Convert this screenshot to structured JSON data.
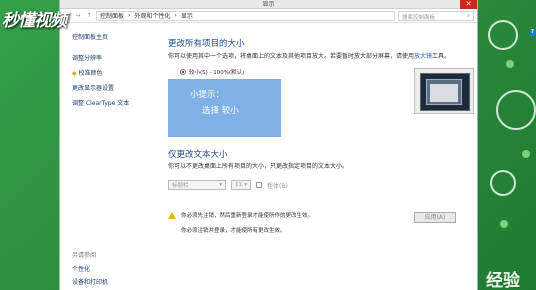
{
  "watermark": {
    "top_left": "秒懂视频",
    "bottom_right": "经验"
  },
  "window": {
    "title": "显示",
    "close": "✕"
  },
  "address": {
    "back": "←",
    "forward": "→",
    "up": "↑",
    "crumbs": [
      "控制面板",
      "外观和个性化",
      "显示"
    ],
    "search_placeholder": "搜索控制面板"
  },
  "sidebar": {
    "home": "控制面板主页",
    "items": [
      "调整分辨率",
      "校准颜色",
      "更改显示器设置",
      "调整 ClearType 文本"
    ],
    "see_also": "另请参阅",
    "also_items": [
      "个性化",
      "设备和打印机"
    ]
  },
  "main": {
    "heading1": "更改所有项目的大小",
    "desc1_pre": "你可以使用其中一个选项，将桌面上的文本及其他项目放大。若要暂时放大部分屏幕，请使用",
    "desc1_link": "放大镜",
    "desc1_post": "工具。",
    "radio_label": "较小(S) - 100%(默认)",
    "tip_line1": "小提示：",
    "tip_line2": "选择 较小",
    "heading2": "仅更改文本大小",
    "desc2": "你可以不更改桌面上所有项目的大小，只更改指定项目的文本大小。",
    "select_item": "标题栏",
    "select_size": "11",
    "bold_label": "粗体(B)",
    "warn_line1": "你必须先注销，然后重新登录才能使所作的更改生效。",
    "warn_line2": "你必须注销并登录，才能使所有更改生效。",
    "apply": "应用(A)"
  },
  "help_icon": "?"
}
